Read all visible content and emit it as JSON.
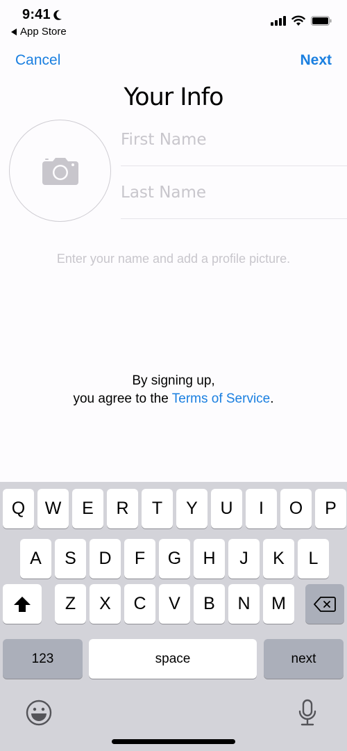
{
  "status_bar": {
    "time": "9:41",
    "focus_icon": "moon-icon",
    "back_app_label": "App Store",
    "icons": [
      "signal-icon",
      "wifi-icon",
      "battery-icon"
    ]
  },
  "nav": {
    "cancel_label": "Cancel",
    "next_label": "Next",
    "title": "Your Info"
  },
  "profile": {
    "avatar_icon": "camera-icon",
    "first_name": {
      "value": "",
      "placeholder": "First Name"
    },
    "last_name": {
      "value": "",
      "placeholder": "Last Name"
    },
    "hint": "Enter your name and add a profile picture."
  },
  "terms": {
    "line1": "By signing up,",
    "line2_prefix": "you agree to the ",
    "link_label": "Terms of Service",
    "line2_suffix": "."
  },
  "keyboard": {
    "row1": [
      "Q",
      "W",
      "E",
      "R",
      "T",
      "Y",
      "U",
      "I",
      "O",
      "P"
    ],
    "row2": [
      "A",
      "S",
      "D",
      "F",
      "G",
      "H",
      "J",
      "K",
      "L"
    ],
    "row3": [
      "Z",
      "X",
      "C",
      "V",
      "B",
      "N",
      "M"
    ],
    "shift_icon": "shift-icon",
    "delete_icon": "delete-icon",
    "numbers_label": "123",
    "space_label": "space",
    "return_label": "next",
    "emoji_icon": "emoji-icon",
    "mic_icon": "microphone-icon"
  },
  "colors": {
    "accent": "#1a7fe0",
    "placeholder": "#c8c6cc",
    "keyboard_bg": "#d3d3d9",
    "key_dark": "#abafba"
  }
}
